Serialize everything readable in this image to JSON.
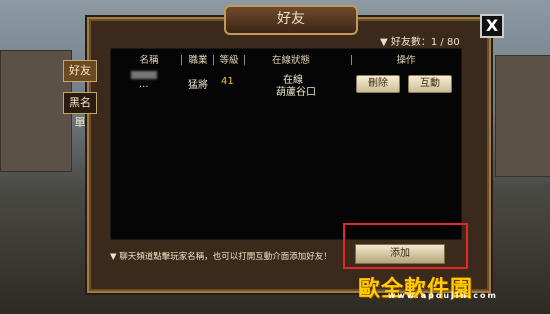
{
  "dialog": {
    "title": "好友",
    "close_label": "X"
  },
  "tabs": [
    {
      "label": "好友"
    },
    {
      "label": "黑名單"
    }
  ],
  "friend_count": "▼ 好友數：1 / 80",
  "table": {
    "headers": [
      "名稱",
      "職業",
      "等級",
      "在線狀態",
      "操作"
    ],
    "rows": [
      {
        "name": "...",
        "class": "猛將",
        "level": "41",
        "status": "在線",
        "location": "葫蘆谷口",
        "actions": [
          "刪除",
          "互動"
        ]
      }
    ]
  },
  "hint": "▼ 聊天頻道點擊玩家名稱，也可以打開互動介面添加好友！",
  "add_button": "添加",
  "watermark": {
    "main": "歐全軟件園",
    "sub": "www.apoujin.com"
  }
}
